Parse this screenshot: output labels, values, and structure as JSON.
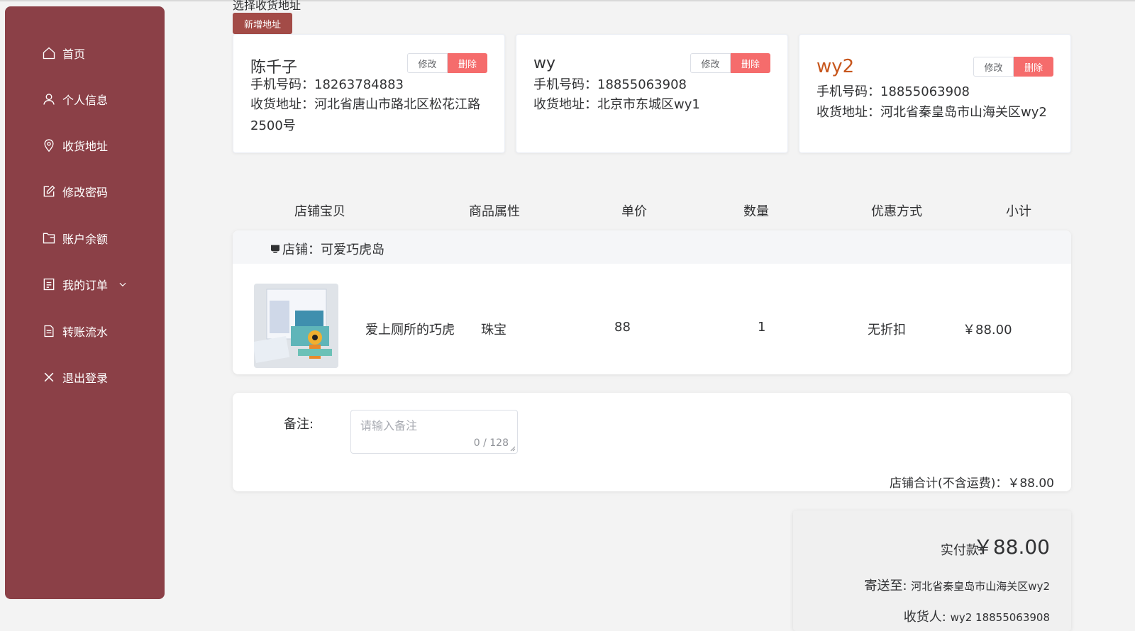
{
  "sidebar": {
    "items": [
      {
        "label": "首页",
        "icon": "home-icon"
      },
      {
        "label": "个人信息",
        "icon": "user-icon"
      },
      {
        "label": "收货地址",
        "icon": "location-icon"
      },
      {
        "label": "修改密码",
        "icon": "edit-icon"
      },
      {
        "label": "账户余额",
        "icon": "wallet-icon"
      },
      {
        "label": "我的订单",
        "icon": "document-icon"
      },
      {
        "label": "转账流水",
        "icon": "file-icon"
      },
      {
        "label": "退出登录",
        "icon": "close-icon"
      }
    ],
    "bg_color": "#8b4047"
  },
  "address": {
    "section_title": "选择收货地址",
    "add_label": "新增地址",
    "edit_label": "修改",
    "delete_label": "删除",
    "cards": [
      {
        "name": "陈千子",
        "phone": "手机号码：18263784883",
        "addr": "收货地址：河北省唐山市路北区松花江路2500号"
      },
      {
        "name": "wy",
        "phone": "手机号码：18855063908",
        "addr": "收货地址：北京市东城区wy1"
      },
      {
        "name": "wy2",
        "phone": "手机号码：18855063908",
        "addr": "收货地址：河北省秦皇岛市山海关区wy2"
      }
    ]
  },
  "table": {
    "headers": [
      "店铺宝贝",
      "商品属性",
      "单价",
      "数量",
      "优惠方式",
      "小计"
    ]
  },
  "shop": {
    "name": "店铺：可爱巧虎岛",
    "item": {
      "title": "爱上厕所的巧虎",
      "attr": "珠宝",
      "price": "88",
      "qty": "1",
      "discount": "无折扣",
      "subtotal": "￥88.00"
    }
  },
  "remark": {
    "label": "备注:",
    "placeholder": "请输入备注",
    "count": "0 / 128",
    "shop_total": "店铺合计(不含运费)：￥88.00"
  },
  "summary": {
    "pay_label": "实付款:",
    "pay_value": "￥88.00",
    "ship_label": "寄送至:",
    "ship_value": "河北省秦皇岛市山海关区wy2",
    "recv_label": "收货人:",
    "recv_value": "wy2 18855063908"
  }
}
